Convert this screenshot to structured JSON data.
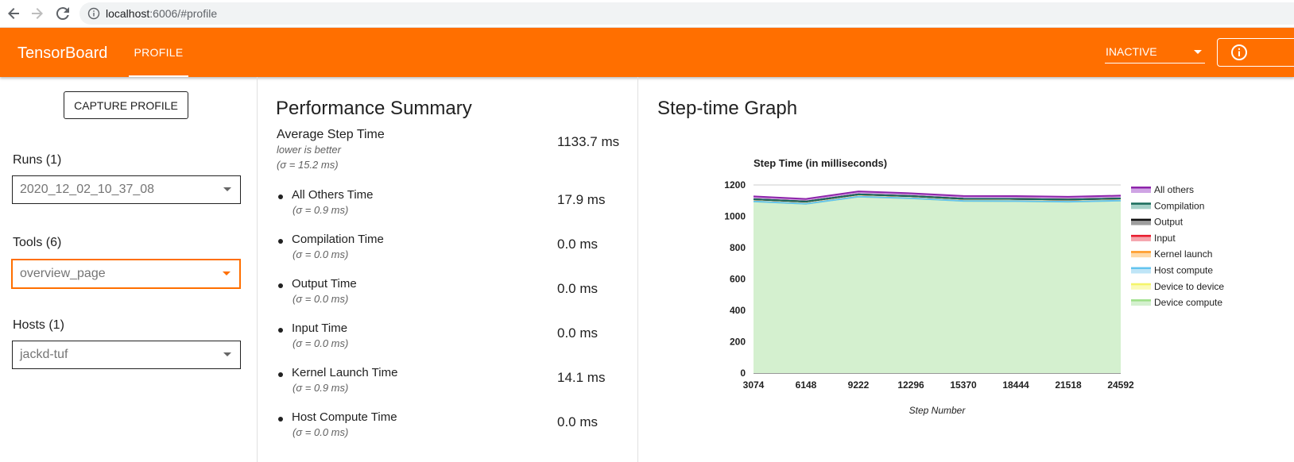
{
  "browser": {
    "url_host": "localhost",
    "url_rest": ":6006/#profile"
  },
  "toolbar": {
    "brand": "TensorBoard",
    "tab_label": "PROFILE",
    "status_value": "INACTIVE"
  },
  "sidebar": {
    "capture_label": "CAPTURE PROFILE",
    "runs_label": "Runs (1)",
    "runs_value": "2020_12_02_10_37_08",
    "tools_label": "Tools (6)",
    "tools_value": "overview_page",
    "hosts_label": "Hosts (1)",
    "hosts_value": "jackd-tuf"
  },
  "summary": {
    "title": "Performance Summary",
    "average": {
      "label": "Average Step Time",
      "hint": "lower is better",
      "sigma": "(σ = 15.2 ms)",
      "value": "1133.7 ms"
    },
    "metrics": [
      {
        "label": "All Others Time",
        "sigma": "(σ = 0.9 ms)",
        "value": "17.9 ms"
      },
      {
        "label": "Compilation Time",
        "sigma": "(σ = 0.0 ms)",
        "value": "0.0 ms"
      },
      {
        "label": "Output Time",
        "sigma": "(σ = 0.0 ms)",
        "value": "0.0 ms"
      },
      {
        "label": "Input Time",
        "sigma": "(σ = 0.0 ms)",
        "value": "0.0 ms"
      },
      {
        "label": "Kernel Launch Time",
        "sigma": "(σ = 0.9 ms)",
        "value": "14.1 ms"
      },
      {
        "label": "Host Compute Time",
        "sigma": "(σ = 0.0 ms)",
        "value": "0.0 ms"
      }
    ]
  },
  "graph": {
    "title": "Step-time Graph"
  },
  "colors": {
    "accent": "#ff6f00",
    "device_compute_fill": "#d4f0cf"
  },
  "chart_data": {
    "type": "area",
    "title": "Step Time (in milliseconds)",
    "xlabel": "Step Number",
    "ylabel": "",
    "x": [
      3074,
      6148,
      9222,
      12296,
      15370,
      18444,
      21518,
      24592
    ],
    "ylim": [
      0,
      1200
    ],
    "yticks": [
      0,
      200,
      400,
      600,
      800,
      1000,
      1200
    ],
    "grid": true,
    "legend": "right",
    "stacked": true,
    "series": [
      {
        "name": "Device compute",
        "color": "#9ee089",
        "fill": "#d4f0cf",
        "values": [
          1095,
          1080,
          1125,
          1115,
          1098,
          1097,
          1093,
          1100
        ]
      },
      {
        "name": "Device to device",
        "color": "#f4f46a",
        "fill": "#fbfbb8",
        "values": [
          0,
          0,
          0,
          0,
          0,
          0,
          0,
          0
        ]
      },
      {
        "name": "Host compute",
        "color": "#64c4ef",
        "fill": "#bfe5f7",
        "values": [
          0,
          0,
          0,
          0,
          0,
          0,
          0,
          0
        ]
      },
      {
        "name": "Kernel launch",
        "color": "#ff9b27",
        "fill": "#ffd9a6",
        "values": [
          14,
          14,
          15,
          14,
          14,
          14,
          14,
          14
        ]
      },
      {
        "name": "Input",
        "color": "#e8192c",
        "fill": "#f5a4ac",
        "values": [
          0,
          0,
          0,
          0,
          0,
          0,
          0,
          0
        ]
      },
      {
        "name": "Output",
        "color": "#111111",
        "fill": "#9e9e9e",
        "values": [
          0,
          0,
          0,
          0,
          0,
          0,
          0,
          0
        ]
      },
      {
        "name": "Compilation",
        "color": "#1a6b5b",
        "fill": "#a6d1c8",
        "values": [
          0,
          0,
          0,
          0,
          0,
          0,
          0,
          0
        ]
      },
      {
        "name": "All others",
        "color": "#8e24aa",
        "fill": "#cfa4e4",
        "values": [
          18,
          17,
          19,
          18,
          18,
          18,
          18,
          18
        ]
      }
    ]
  }
}
